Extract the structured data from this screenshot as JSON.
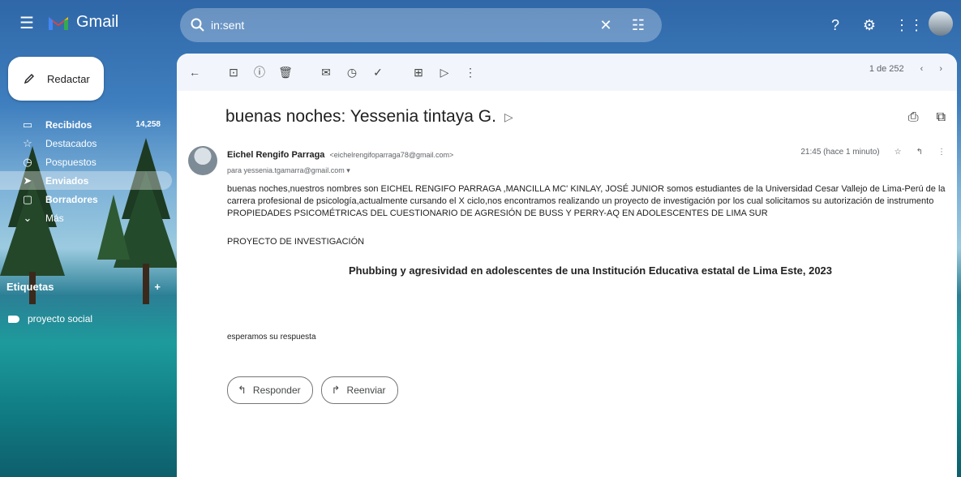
{
  "app": {
    "name": "Gmail"
  },
  "search": {
    "query": "in:sent"
  },
  "sidebar": {
    "compose_label": "Redactar",
    "items": [
      {
        "label": "Recibidos",
        "count": "14,258"
      },
      {
        "label": "Destacados"
      },
      {
        "label": "Pospuestos"
      },
      {
        "label": "Enviados"
      },
      {
        "label": "Borradores"
      },
      {
        "label": "Más"
      }
    ],
    "labels_heading": "Etiquetas",
    "labels": [
      {
        "name": "proyecto social"
      }
    ]
  },
  "pager": {
    "text": "1 de 252"
  },
  "email": {
    "subject": "buenas noches: Yessenia tintaya G.",
    "sender_name": "Eichel Rengifo Parraga",
    "sender_email": "<eichelrengifoparraga78@gmail.com>",
    "to": "para yessenia.tgamarra@gmail.com",
    "time": "21:45 (hace 1 minuto)",
    "body_lines": [
      "buenas noches,nuestros nombres son EICHEL RENGIFO PARRAGA ,MANCILLA MC' KINLAY, JOSÉ JUNIOR somos estudiantes de la Universidad Cesar Vallejo de Lima-Perú de la",
      "carrera profesional de psicología,actualmente cursando el X ciclo,nos encontramos realizando un proyecto de investigación por los cual solicitamos su autorización de instrumento",
      "PROPIEDADES PSICOMÉTRICAS DEL CUESTIONARIO DE AGRESIÓN DE BUSS Y PERRY-AQ EN ADOLESCENTES DE LIMA SUR"
    ],
    "project_heading": "PROYECTO DE INVESTIGACIÓN",
    "project_title": "Phubbing y agresividad en adolescentes de una Institución Educativa estatal de Lima Este, 2023",
    "closing": "esperamos su respuesta"
  },
  "actions": {
    "reply": "Responder",
    "forward": "Reenviar"
  }
}
